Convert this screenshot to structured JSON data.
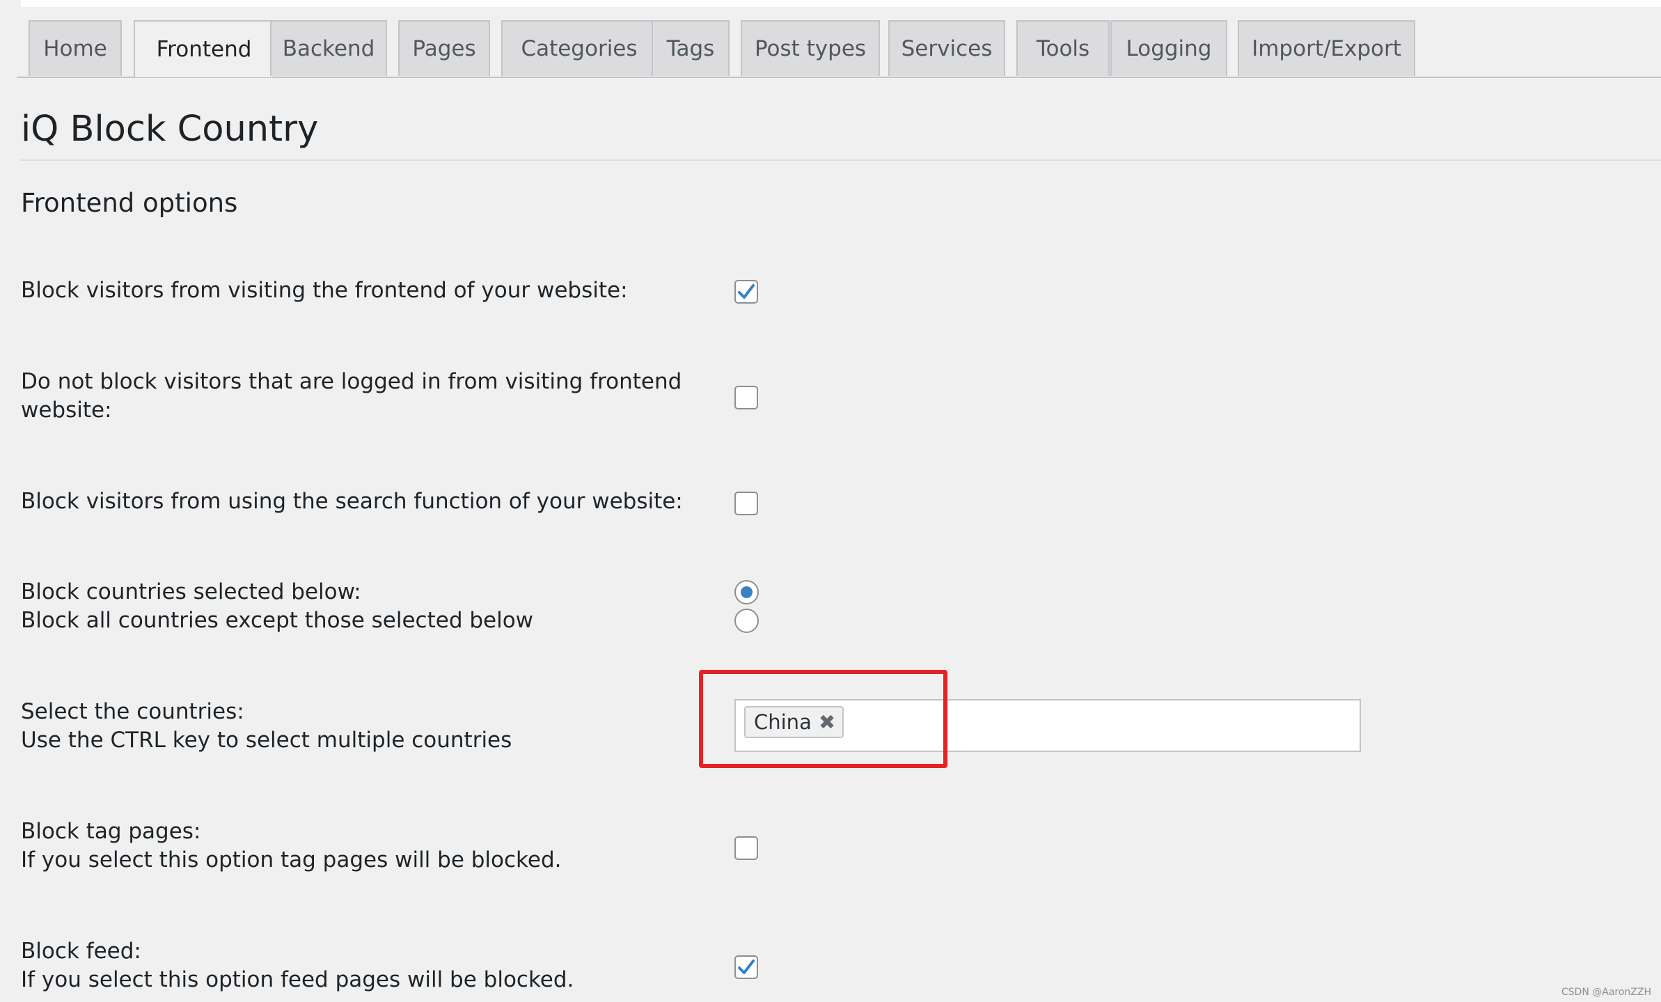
{
  "tabs": [
    {
      "label": "Home",
      "active": false
    },
    {
      "label": "Frontend",
      "active": true
    },
    {
      "label": "Backend",
      "active": false
    },
    {
      "label": "Pages",
      "active": false
    },
    {
      "label": "Categories",
      "active": false
    },
    {
      "label": "Tags",
      "active": false
    },
    {
      "label": "Post types",
      "active": false
    },
    {
      "label": "Services",
      "active": false
    },
    {
      "label": "Tools",
      "active": false
    },
    {
      "label": "Logging",
      "active": false
    },
    {
      "label": "Import/Export",
      "active": false
    }
  ],
  "page": {
    "title": "iQ Block Country",
    "section_title": "Frontend options"
  },
  "options": {
    "block_frontend": {
      "label": "Block visitors from visiting the frontend of your website:",
      "checked": true
    },
    "logged_in": {
      "label_line1": "Do not block visitors that are logged in from visiting frontend",
      "label_line2": "website:",
      "checked": false
    },
    "block_search": {
      "label": "Block visitors from using the search function of your website:",
      "checked": false
    },
    "block_mode": {
      "label_selected": "Block countries selected below:",
      "label_except": "Block all countries except those selected below",
      "selected": "selected"
    },
    "countries": {
      "label_line1": "Select the countries:",
      "label_line2": "Use the CTRL key to select multiple countries",
      "selected": [
        "China"
      ],
      "remove_glyph": "✖"
    },
    "block_tag_pages": {
      "label_line1": "Block tag pages:",
      "label_line2": "If you select this option tag pages will be blocked.",
      "checked": false
    },
    "block_feed": {
      "label_line1": "Block feed:",
      "label_line2": "If you select this option feed pages will be blocked.",
      "checked": true
    }
  },
  "colors": {
    "accent": "#3582c4",
    "highlight": "#e32326",
    "background": "#f0f0f1"
  },
  "watermark": "CSDN @AaronZZH"
}
